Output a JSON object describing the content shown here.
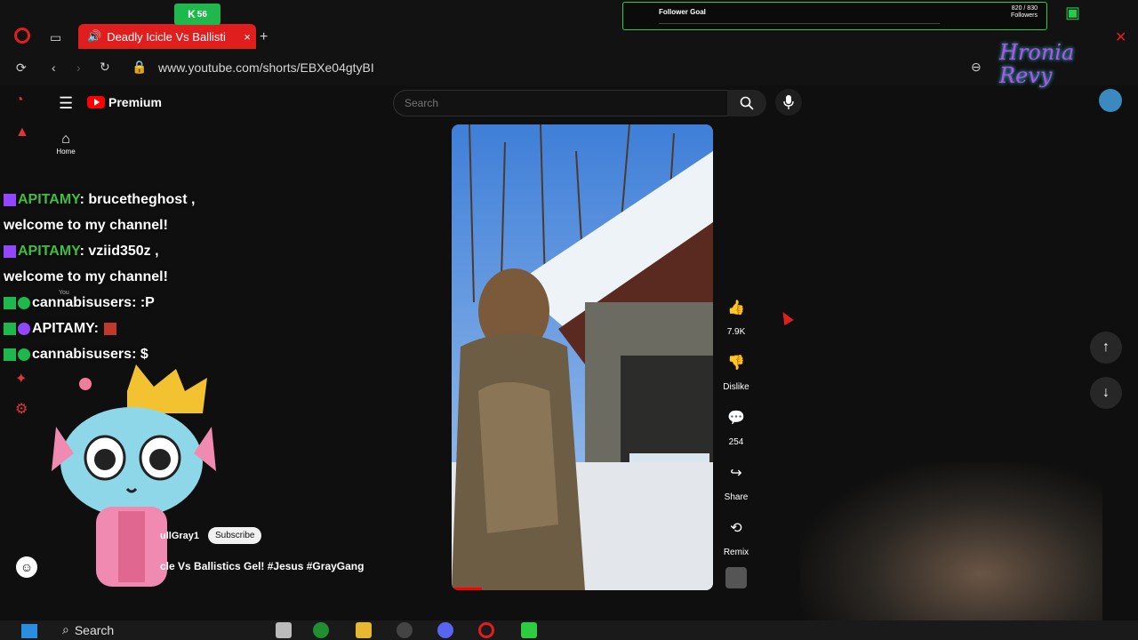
{
  "browser": {
    "tab_title": "Deadly Icicle Vs Ballisti",
    "new_tab": "+",
    "url": "www.youtube.com/shorts/EBXe04gtyBI"
  },
  "youtube": {
    "brand": "Premium",
    "search_placeholder": "Search",
    "home_label": "Home",
    "you_label": "You"
  },
  "video": {
    "channel": "ullGray1",
    "subscribe_label": "Subscribe",
    "title": "cle Vs Ballistics Gel! #Jesus #GrayGang"
  },
  "actions": {
    "like_count": "7.9K",
    "dislike_label": "Dislike",
    "comment_count": "254",
    "share_label": "Share",
    "remix_label": "Remix"
  },
  "chat": [
    {
      "user": "APITAMY",
      "message": ": brucetheghost ,"
    },
    {
      "user": "",
      "message": "welcome to my channel!"
    },
    {
      "user": "APITAMY",
      "message": ": vziid350z ,"
    },
    {
      "user": "",
      "message": "welcome to my channel!"
    },
    {
      "user": "cannabisusers",
      "message": ": :P"
    },
    {
      "user": "APITAMY",
      "message": ":"
    },
    {
      "user": "cannabisusers",
      "message": ": $"
    }
  ],
  "overlay": {
    "kick_count": "56",
    "follower_goal_title": "Follower Goal",
    "follower_goal_count": "820 / 830",
    "follower_goal_unit": "Followers",
    "brand_text": "Hronia Revy"
  },
  "taskbar": {
    "search_label": "Search"
  },
  "colors": {
    "opera_red": "#e01e1e",
    "youtube_red": "#ff0000",
    "kick_green": "#1fb84d",
    "background": "#0f0f0f"
  }
}
